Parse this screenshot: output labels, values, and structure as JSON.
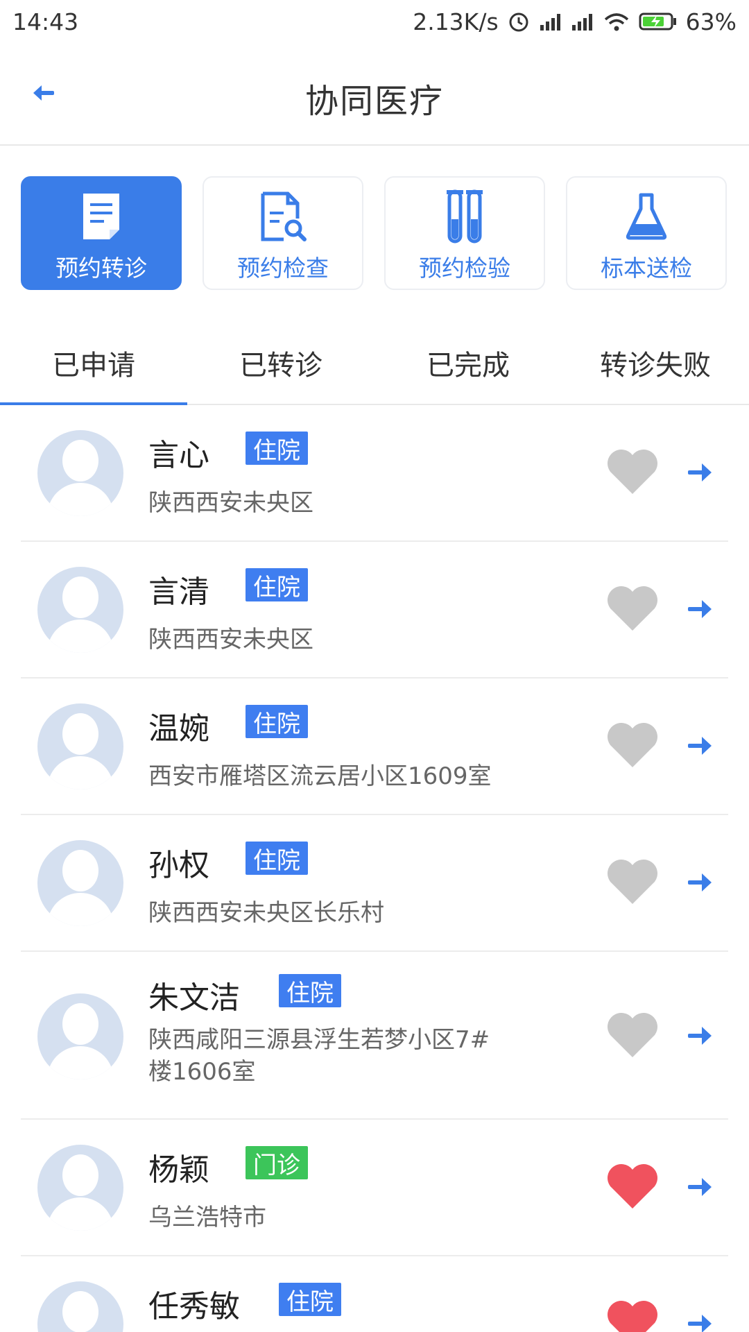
{
  "status": {
    "time": "14:43",
    "speed": "2.13K/s",
    "battery": "63%"
  },
  "header": {
    "title": "协同医疗"
  },
  "services": [
    {
      "label": "预约转诊",
      "icon": "document-icon",
      "active": true
    },
    {
      "label": "预约检查",
      "icon": "document-search-icon",
      "active": false
    },
    {
      "label": "预约检验",
      "icon": "test-tube-icon",
      "active": false
    },
    {
      "label": "标本送检",
      "icon": "flask-icon",
      "active": false
    }
  ],
  "tabs": [
    {
      "label": "已申请",
      "active": true
    },
    {
      "label": "已转诊",
      "active": false
    },
    {
      "label": "已完成",
      "active": false
    },
    {
      "label": "转诊失败",
      "active": false
    }
  ],
  "colors": {
    "accent": "#3a7de8",
    "inpatient": "#3f7ef0",
    "outpatient": "#3cc55a",
    "heart_on": "#f0525e",
    "heart_off": "#c8c8c8"
  },
  "patients": [
    {
      "name": "言心",
      "badge": "住院",
      "type": "inpatient",
      "address": "陕西西安未央区",
      "favorite": false
    },
    {
      "name": "言清",
      "badge": "住院",
      "type": "inpatient",
      "address": "陕西西安未央区",
      "favorite": false
    },
    {
      "name": "温婉",
      "badge": "住院",
      "type": "inpatient",
      "address": "西安市雁塔区流云居小区1609室",
      "favorite": false
    },
    {
      "name": "孙权",
      "badge": "住院",
      "type": "inpatient",
      "address": "陕西西安未央区长乐村",
      "favorite": false
    },
    {
      "name": "朱文洁",
      "badge": "住院",
      "type": "inpatient",
      "address": "陕西咸阳三源县浮生若梦小区7#楼1606室",
      "favorite": false
    },
    {
      "name": "杨颖",
      "badge": "门诊",
      "type": "outpatient",
      "address": "乌兰浩特市",
      "favorite": true
    },
    {
      "name": "任秀敏",
      "badge": "住院",
      "type": "inpatient",
      "address": "",
      "favorite": true
    }
  ]
}
